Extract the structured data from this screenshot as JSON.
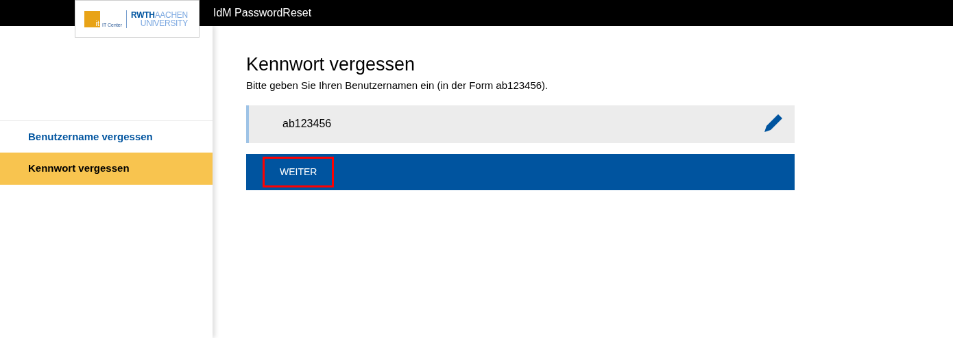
{
  "header": {
    "title": "IdM PasswordReset",
    "logo": {
      "mark": "it",
      "center": "IT Center",
      "university_top_bold": "RWTH",
      "university_top": "AACHEN",
      "university_bottom": "UNIVERSITY"
    }
  },
  "sidebar": {
    "items": [
      {
        "label": "Benutzername vergessen",
        "selected": false
      },
      {
        "label": "Kennwort vergessen",
        "selected": true
      }
    ]
  },
  "main": {
    "heading": "Kennwort vergessen",
    "instruction": "Bitte geben Sie Ihren Benutzernamen ein (in der Form ab123456).",
    "username_field": {
      "value": "ab123456"
    },
    "submit": {
      "label": "WEITER",
      "highlighted": true
    }
  }
}
